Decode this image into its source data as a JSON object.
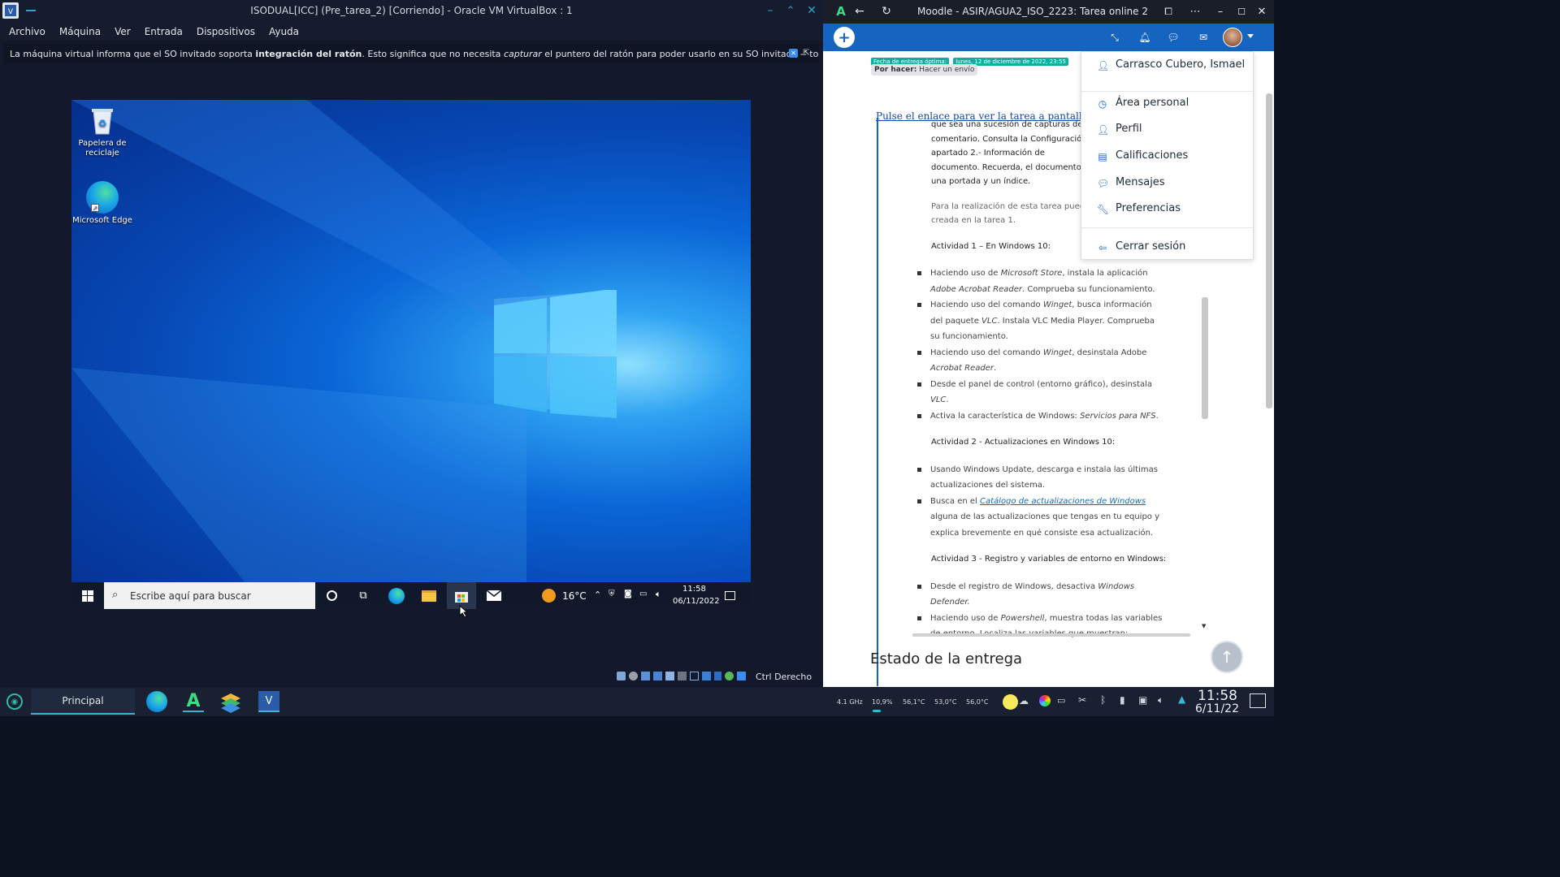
{
  "vbox": {
    "title": "ISODUAL[ICC] (Pre_tarea_2) [Corriendo] - Oracle VM VirtualBox : 1",
    "menu": [
      "Archivo",
      "Máquina",
      "Ver",
      "Entrada",
      "Dispositivos",
      "Ayuda"
    ],
    "notice": {
      "part1": "La máquina virtual informa que el SO invitado soporta ",
      "bold": "integración del ratón",
      "part2": ". Esto significa que no necesita ",
      "italic": "capturar",
      "part3": " el puntero del ratón para poder usarlo en su SO invitado -- todas las acciones del ratón que"
    },
    "host_key": "Ctrl Derecho"
  },
  "guest": {
    "desktop_icons": [
      {
        "label": "Papelera de reciclaje",
        "icon": "recycle-bin-icon"
      },
      {
        "label": "Microsoft Edge",
        "icon": "edge-icon"
      }
    ],
    "search_placeholder": "Escribe aquí para buscar",
    "weather": "16°C",
    "time": "11:58",
    "date": "06/11/2022"
  },
  "browser": {
    "title": "Moodle - ASIR/AGUA2_ISO_2223: Tarea online 2",
    "due_label": "Fecha de entrega óptima:",
    "due_value": "lunes, 12 de diciembre de 2022, 23:55",
    "todo_label": "Por hacer:",
    "todo_value": "Hacer un envío",
    "fullscreen_link": "Pulse el enlace para ver la tarea a pantalla compl",
    "intro_lines": [
      "que sea una sucesión de capturas de pa",
      "comentario. Consulta la Configuració",
      "apartado 2.- Información de",
      "documento. Recuerda, el documento de",
      "una portada y un índice."
    ],
    "para_lines": [
      "Para la realización de esta tarea puedes",
      "creada en la tarea 1."
    ],
    "act1_title": "Actividad 1 – En Windows 10:",
    "act1_items": [
      {
        "pre": "Haciendo uso de ",
        "em": "Microsoft Store",
        "post": ", instala la aplicación "
      },
      {
        "pre": "",
        "em": "Adobe Acrobat Reader",
        "post": ". Comprueba su funcionamiento."
      },
      {
        "pre": "Haciendo uso del comando ",
        "em": "Winget",
        "post": ", busca información"
      },
      {
        "pre": "del paquete ",
        "em": "VLC",
        "post": ". Instala VLC Media Player. Comprueba"
      },
      {
        "pre": "su funcionamiento.",
        "em": "",
        "post": ""
      },
      {
        "pre": "Haciendo uso del comando ",
        "em": "Winget",
        "post": ", desinstala Adobe"
      },
      {
        "pre": "",
        "em": "Acrobat Reader",
        "post": "."
      },
      {
        "pre": "Desde el panel de control (entorno gráfico), desinstala",
        "em": "",
        "post": ""
      },
      {
        "pre": "",
        "em": "VLC",
        "post": "."
      },
      {
        "pre": "Activa la característica de Windows: ",
        "em": "Servicios para NFS",
        "post": "."
      }
    ],
    "act2_title": "Actividad 2 - Actualizaciones en Windows 10:",
    "act2_lines": [
      "Usando Windows Update, descarga e instala las últimas",
      "actualizaciones del sistema.",
      "Busca en el ",
      "alguna de las actualizaciones que tengas en tu equipo y",
      "explica brevemente en qué consiste esa actualización."
    ],
    "catalog_link": "Catálogo de actualizaciones de Windows",
    "act3_title": "Actividad 3 - Registro y variables de entorno en Windows:",
    "act3_lines": [
      "Desde el registro de Windows, desactiva ",
      "Defender.",
      "Haciendo uso de ",
      "de entorno. Localiza las variables que muestran:"
    ],
    "act3_em": [
      "Windows",
      "Powershell",
      ", muestra todas las variables"
    ],
    "section_title": "Estado de la entrega",
    "user_menu": [
      {
        "label": "Carrasco Cubero, Ismael",
        "icon": "user-icon"
      },
      {
        "label": "Área personal",
        "icon": "dashboard-icon"
      },
      {
        "label": "Perfil",
        "icon": "profile-icon"
      },
      {
        "label": "Calificaciones",
        "icon": "grades-icon"
      },
      {
        "label": "Mensajes",
        "icon": "messages-icon"
      },
      {
        "label": "Preferencias",
        "icon": "wrench-icon"
      },
      {
        "label": "Cerrar sesión",
        "icon": "logout-icon"
      }
    ]
  },
  "host": {
    "task_label": "Principal",
    "cpu_freq": "4.1 GHz",
    "cpu_load": "10,9%",
    "temps": [
      "56,1°C",
      "53,0°C",
      "56,0°C"
    ],
    "time": "11:58",
    "date": "6/11/22"
  }
}
